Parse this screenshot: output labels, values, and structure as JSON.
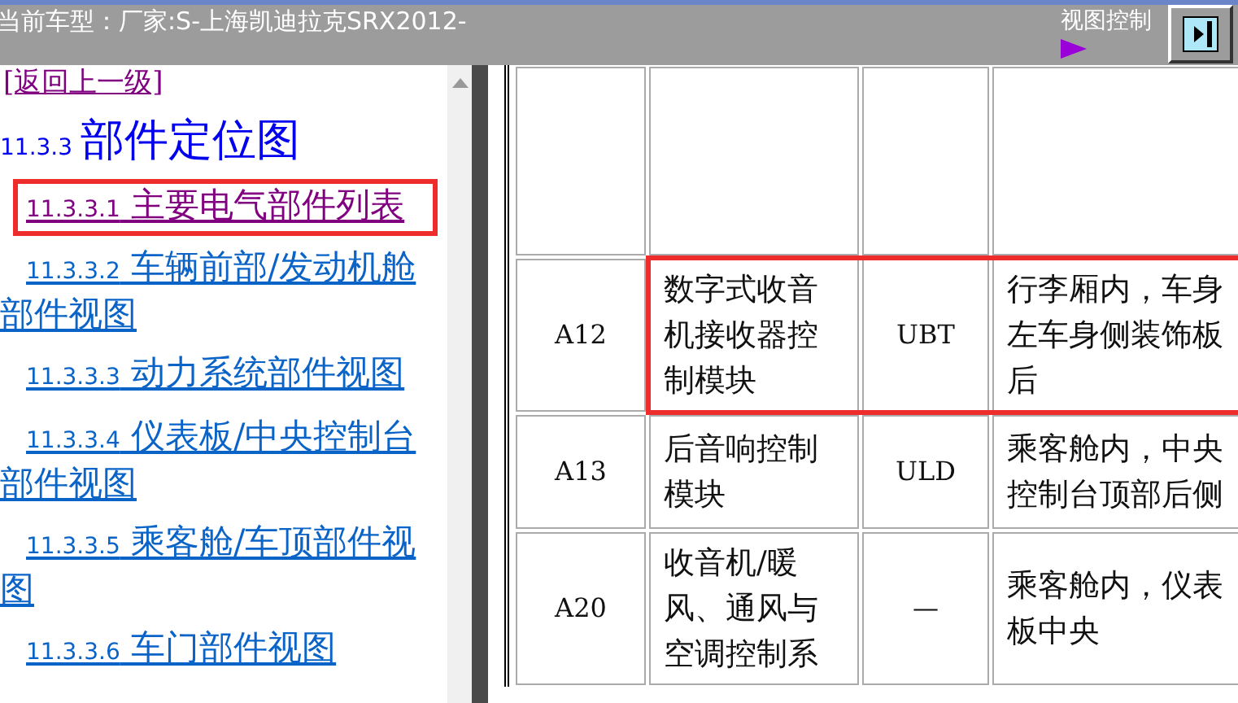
{
  "header": {
    "title": "当前车型：厂家:S-上海凯迪拉克SRX2012-",
    "view_control": "视图控制"
  },
  "sidebar": {
    "back_link": {
      "label": "[返回上一级]",
      "visited": true
    },
    "heading": {
      "number": "11.3.3",
      "title": "部件定位图"
    },
    "items": [
      {
        "number": "11.3.3.1",
        "title": "主要电气部件列表",
        "visited": true,
        "highlighted": true
      },
      {
        "number": "11.3.3.2",
        "title": "车辆前部/发动机舱部件视图",
        "visited": false,
        "highlighted": false
      },
      {
        "number": "11.3.3.3",
        "title": "动力系统部件视图",
        "visited": false,
        "highlighted": false
      },
      {
        "number": "11.3.3.4",
        "title": "仪表板/中央控制台部件视图",
        "visited": false,
        "highlighted": false
      },
      {
        "number": "11.3.3.5",
        "title": "乘客舱/车顶部件视图",
        "visited": false,
        "highlighted": false
      },
      {
        "number": "11.3.3.6",
        "title": "车门部件视图",
        "visited": false,
        "highlighted": false
      }
    ]
  },
  "table": {
    "rows": [
      {
        "kind": "blank"
      },
      {
        "kind": "data",
        "highlighted": true,
        "code": "A12",
        "name": "数字式收音机接收器控制模块",
        "connector": "UBT",
        "location": "行李厢内，车身左车身侧装饰板后"
      },
      {
        "kind": "data",
        "highlighted": false,
        "code": "A13",
        "name": "后音响控制模块",
        "connector": "ULD",
        "location": "乘客舱内，中央控制台顶部后侧"
      },
      {
        "kind": "data",
        "highlighted": false,
        "code": "A20",
        "name": "收音机/暖风、通风与空调控制系",
        "connector": "—",
        "location": "乘客舱内，仪表板中央"
      }
    ]
  }
}
